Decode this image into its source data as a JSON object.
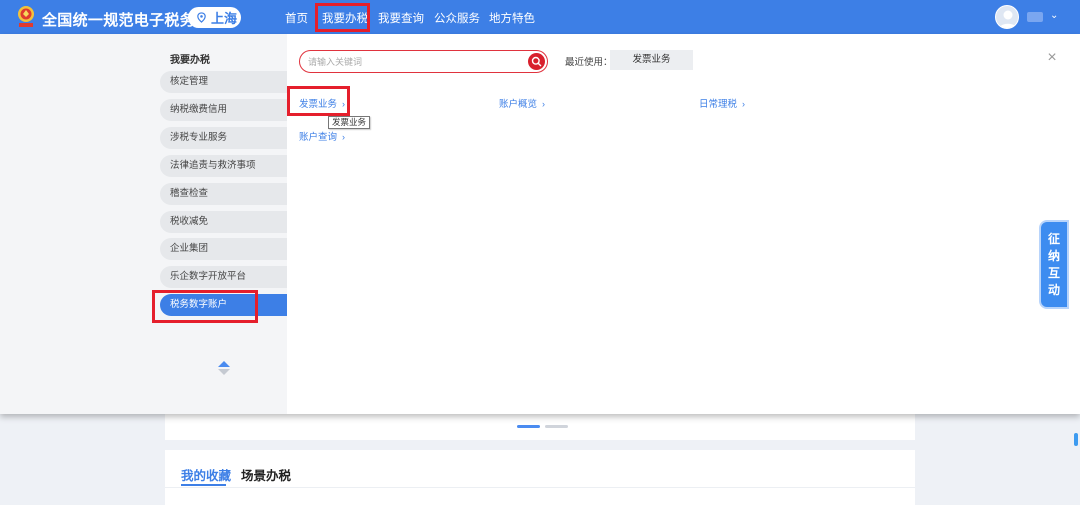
{
  "header": {
    "site_title": "全国统一规范电子税务局",
    "region": "上海",
    "nav": [
      {
        "label": "首页"
      },
      {
        "label": "我要办税",
        "active": true
      },
      {
        "label": "我要查询"
      },
      {
        "label": "公众服务"
      },
      {
        "label": "地方特色"
      }
    ],
    "icons": {
      "logo": "tax-emblem-icon",
      "region": "location-pin-icon",
      "avatar": "user-avatar-icon",
      "caret": "chevron-down-icon"
    }
  },
  "sidebar": {
    "title": "我要办税",
    "items": [
      {
        "label": "核定管理"
      },
      {
        "label": "纳税缴费信用"
      },
      {
        "label": "涉税专业服务"
      },
      {
        "label": "法律追责与救济事项"
      },
      {
        "label": "稽查检查"
      },
      {
        "label": "税收减免"
      },
      {
        "label": "企业集团"
      },
      {
        "label": "乐企数字开放平台"
      },
      {
        "label": "税务数字账户",
        "active": true
      }
    ]
  },
  "search": {
    "placeholder": "请输入关键词",
    "value": ""
  },
  "recent": {
    "label": "最近使用：",
    "items": [
      "发票业务"
    ]
  },
  "menu_links": [
    {
      "label": "发票业务"
    },
    {
      "label": "账户概览"
    },
    {
      "label": "日常理税"
    },
    {
      "label": "账户查询"
    }
  ],
  "tooltip": "发票业务",
  "float_tab": [
    "征",
    "纳",
    "互",
    "动"
  ],
  "background": {
    "tabs": [
      {
        "label": "我的收藏",
        "active": true
      },
      {
        "label": "场景办税"
      }
    ]
  },
  "colors": {
    "header_bg": "#3d7fe6",
    "highlight_box": "#e51f2c",
    "search_button": "#d8202d",
    "link": "#3d7fe6"
  }
}
